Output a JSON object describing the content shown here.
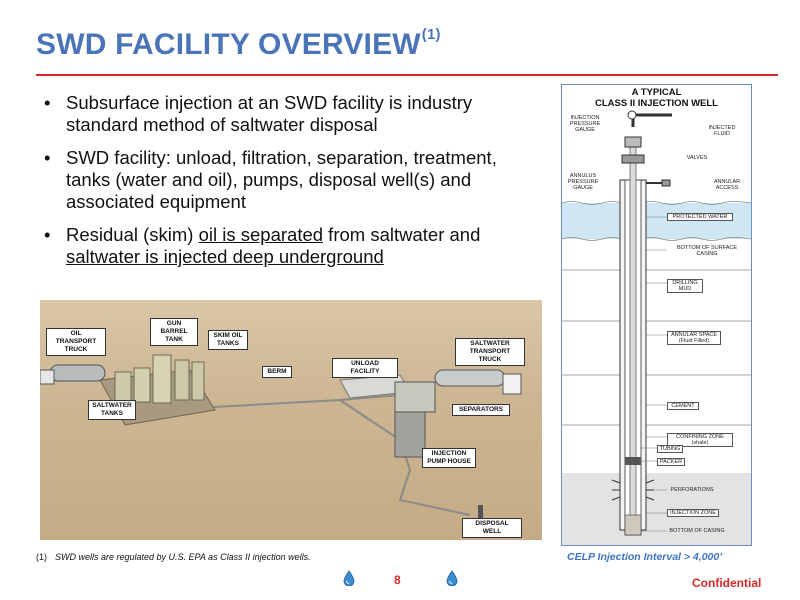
{
  "title": {
    "text": "SWD FACILITY OVERVIEW",
    "sup": "(1)"
  },
  "bullets": [
    {
      "parts": [
        {
          "text": "Subsurface injection at an SWD facility is industry standard method of saltwater disposal",
          "u": false
        }
      ]
    },
    {
      "parts": [
        {
          "text": "SWD facility: unload, filtration, separation, treatment, tanks (water and oil), pumps, disposal well(s) and associated equipment",
          "u": false
        }
      ]
    },
    {
      "parts": [
        {
          "text": "Residual (skim) ",
          "u": false
        },
        {
          "text": "oil is separated",
          "u": true
        },
        {
          "text": " from saltwater and ",
          "u": false
        },
        {
          "text": "saltwater is injected deep underground",
          "u": true
        }
      ]
    }
  ],
  "facility_labels": {
    "oil_transport": "OIL TRANSPORT TRUCK",
    "gun_barrel": "GUN BARREL TANK",
    "skim_oil": "SKIM OIL TANKS",
    "berm": "BERM",
    "unload": "UNLOAD FACILITY",
    "saltwater_truck": "SALTWATER TRANSPORT TRUCK",
    "saltwater_tanks": "SALTWATER TANKS",
    "separators": "SEPARATORS",
    "pump_house": "INJECTION PUMP HOUSE",
    "disposal_well": "DISPOSAL WELL"
  },
  "well_diagram": {
    "title_line1": "A TYPICAL",
    "title_line2": "CLASS II INJECTION WELL",
    "labels": {
      "injection_gauge": "INJECTION PRESSURE GAUGE",
      "injected_fluid": "INJECTED FLUID",
      "valves": "VALVES",
      "annulus_gauge": "ANNULUS PRESSURE GAUGE",
      "annular_access": "ANNULAR ACCESS",
      "protected_water": "PROTECTED WATER",
      "bottom_surface_casing": "BOTTOM OF SURFACE CASING",
      "drilling_mud": "DRILLING MUD",
      "annular_space": "ANNULAR SPACE (Fluid Filled)",
      "cement": "CEMENT",
      "confining_zone": "CONFINING ZONE (shale)",
      "tubing": "TUBING",
      "packer": "PACKER",
      "perforations": "PERFORATIONS",
      "injection_zone": "INJECTION ZONE",
      "bottom_casing": "BOTTOM OF CASING"
    }
  },
  "caption": "CELP Injection Interval > 4,000’",
  "footnote": {
    "num": "(1)",
    "text": "SWD wells are regulated by U.S. EPA as Class II injection wells."
  },
  "page_number": "8",
  "confidential": "Confidential",
  "colors": {
    "title": "#4a74b8",
    "accent_red": "#d42a2a",
    "caption_blue": "#3f73c4"
  }
}
